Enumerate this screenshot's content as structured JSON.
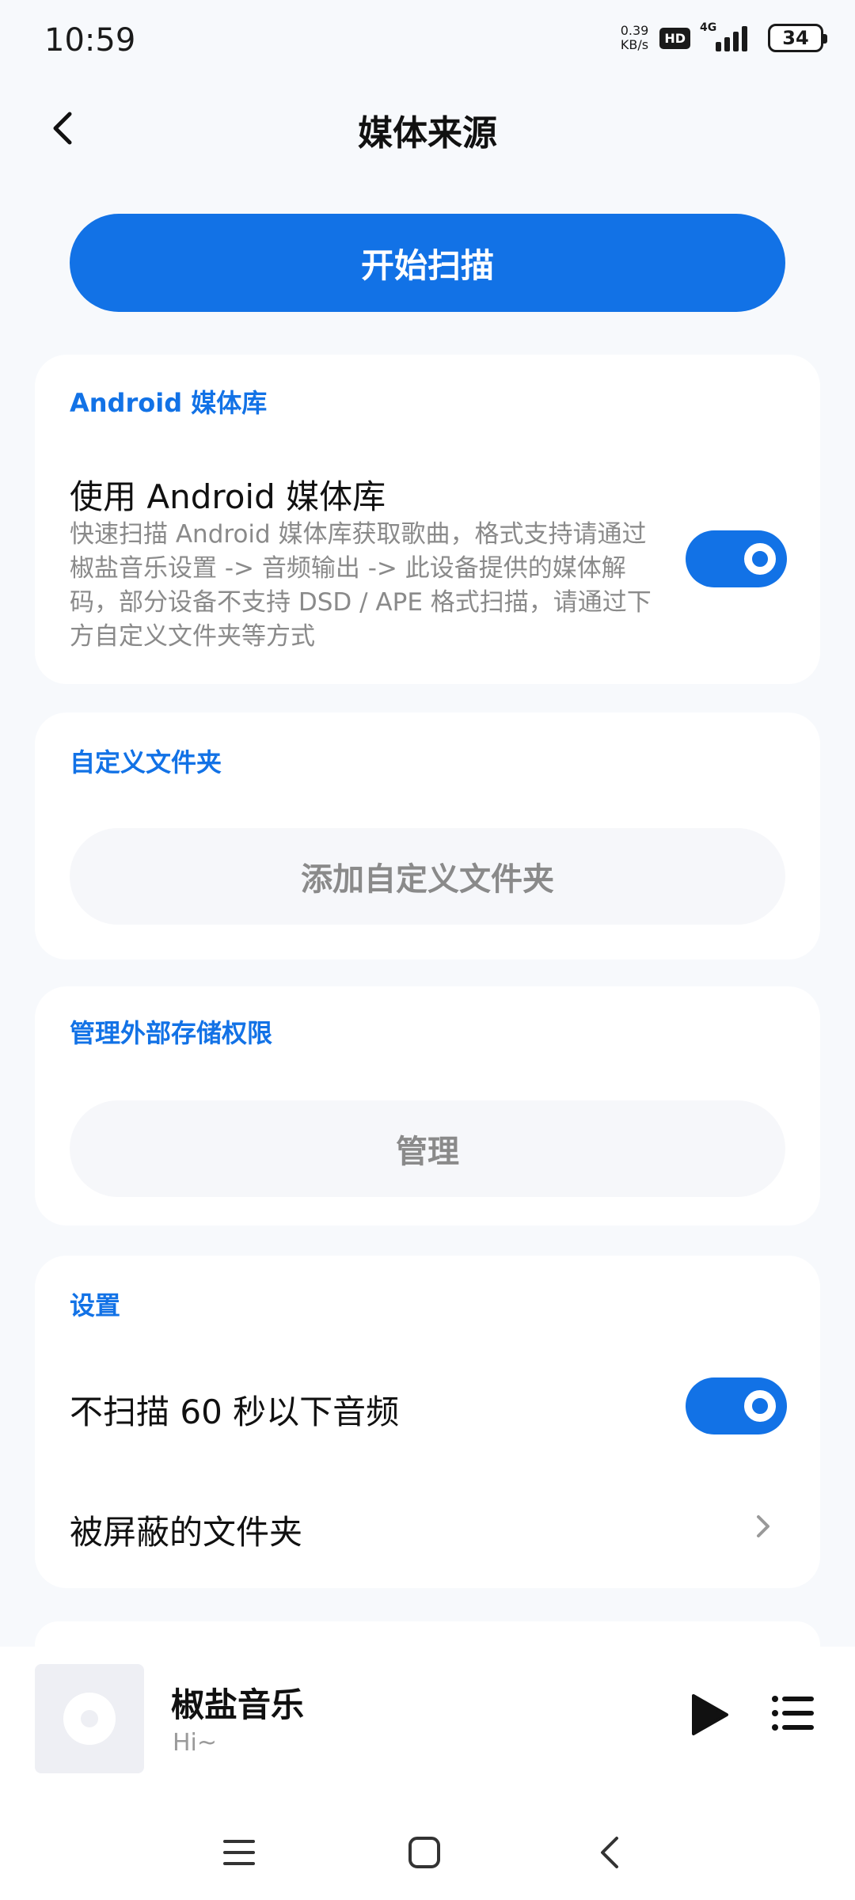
{
  "status": {
    "time": "10:59",
    "net_speed_value": "0.39",
    "net_speed_unit": "KB/s",
    "hd": "HD",
    "network": "4G",
    "battery": "34"
  },
  "header": {
    "title": "媒体来源"
  },
  "scan_button": "开始扫描",
  "android_card": {
    "title": "Android 媒体库",
    "row_title": "使用 Android 媒体库",
    "row_desc": "快速扫描 Android 媒体库获取歌曲，格式支持请通过椒盐音乐设置 -> 音频输出 -> 此设备提供的媒体解码，部分设备不支持 DSD / APE 格式扫描，请通过下方自定义文件夹等方式",
    "toggle_on": true
  },
  "custom_folder_card": {
    "title": "自定义文件夹",
    "button": "添加自定义文件夹"
  },
  "storage_card": {
    "title": "管理外部存储权限",
    "button": "管理"
  },
  "settings_card": {
    "title": "设置",
    "skip_short_audio": "不扫描 60 秒以下音频",
    "skip_short_audio_on": true,
    "blocked_folders": "被屏蔽的文件夹"
  },
  "player": {
    "title": "椒盐音乐",
    "subtitle": "Hi~"
  },
  "colors": {
    "accent": "#1272e6",
    "background": "#f7f9fc",
    "card": "#ffffff",
    "secondary_text": "#8a8a8a"
  }
}
